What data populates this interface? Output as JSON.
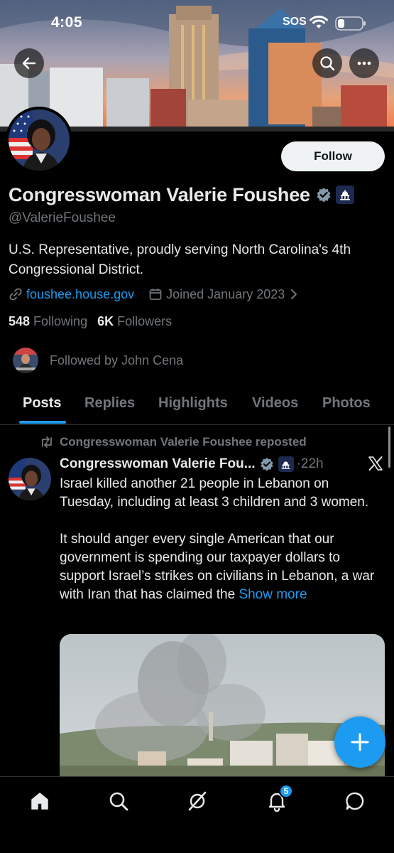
{
  "status_bar": {
    "time": "4:05",
    "sos": "SOS"
  },
  "profile": {
    "display_name": "Congresswoman Valerie Foushee",
    "handle": "@ValerieFoushee",
    "bio": "U.S. Representative, proudly serving North Carolina's 4th Congressional District.",
    "website": "foushee.house.gov",
    "joined": "Joined January 2023",
    "following_count": "548",
    "following_label": "Following",
    "followers_count": "6K",
    "followers_label": "Followers",
    "followed_by": "Followed by John Cena",
    "follow_label": "Follow"
  },
  "tabs": [
    {
      "label": "Posts",
      "active": true
    },
    {
      "label": "Replies",
      "active": false
    },
    {
      "label": "Highlights",
      "active": false
    },
    {
      "label": "Videos",
      "active": false
    },
    {
      "label": "Photos",
      "active": false
    }
  ],
  "post": {
    "repost_label": "Congresswoman Valerie Foushee reposted",
    "author": "Congresswoman Valerie Fou...",
    "time": "·22h",
    "paragraph1": "Israel killed another 21 people in Lebanon on Tuesday, including at least 3 children and 3 women.",
    "paragraph2": "It should anger every single American that our government is spending our taxpayer dollars to support Israel’s strikes on civilians in Lebanon, a war with Iran that has claimed the",
    "show_more": "Show more"
  },
  "nav": {
    "notifications_badge": "5"
  },
  "colors": {
    "accent": "#1d9bf0",
    "background": "#000000",
    "text_primary": "#e7e9ea",
    "text_secondary": "#71767b"
  },
  "icons": {
    "back": "arrow-left-icon",
    "search": "search-icon",
    "more": "more-horizontal-icon",
    "verified": "verified-badge-icon",
    "government": "capitol-building-icon",
    "link": "link-icon",
    "calendar": "calendar-icon",
    "repost": "repost-icon",
    "x_logo": "x-logo-icon",
    "compose": "plus-icon",
    "home": "home-icon",
    "explore": "search-icon",
    "grok": "grok-icon",
    "notifications": "bell-icon",
    "messages": "chat-bubble-icon"
  }
}
